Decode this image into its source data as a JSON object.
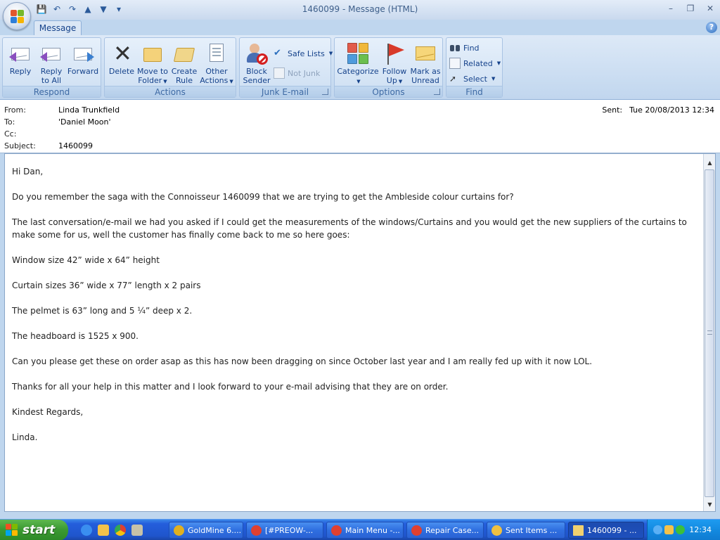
{
  "window": {
    "title": "1460099  - Message (HTML)",
    "minimize": "–",
    "restore": "❐",
    "close": "✕"
  },
  "qat": {
    "save": "💾",
    "undo": "↶",
    "redo": "↷",
    "prev": "▲",
    "next": "▼",
    "more": "▾"
  },
  "tabs": [
    {
      "label": "Message"
    }
  ],
  "help": "?",
  "ribbon": {
    "respond": {
      "label": "Respond",
      "reply": "Reply",
      "reply_all_1": "Reply",
      "reply_all_2": "to All",
      "forward": "Forward"
    },
    "actions": {
      "label": "Actions",
      "delete": "Delete",
      "move_1": "Move to",
      "move_2": "Folder",
      "create_1": "Create",
      "create_2": "Rule",
      "other_1": "Other",
      "other_2": "Actions"
    },
    "junk": {
      "label": "Junk E-mail",
      "block_1": "Block",
      "block_2": "Sender",
      "safe_lists": "Safe Lists",
      "not_junk": "Not Junk"
    },
    "options": {
      "label": "Options",
      "categorize": "Categorize",
      "follow_1": "Follow",
      "follow_2": "Up",
      "mark_1": "Mark as",
      "mark_2": "Unread"
    },
    "find": {
      "label": "Find",
      "find": "Find",
      "related": "Related",
      "select": "Select"
    },
    "colors": {
      "categorize": [
        "#e25b4b",
        "#f0b83a",
        "#4f9bdc",
        "#6bbf4f"
      ]
    }
  },
  "header": {
    "from_label": "From:",
    "from": "Linda Trunkfield",
    "to_label": "To:",
    "to": "'Daniel Moon'",
    "cc_label": "Cc:",
    "cc": "",
    "subject_label": "Subject:",
    "subject": "1460099",
    "sent_label": "Sent:",
    "sent": "Tue 20/08/2013 12:34"
  },
  "body": {
    "paragraphs": [
      "Hi Dan,",
      "Do you remember the saga with the Connoisseur 1460099 that we are trying to get the Ambleside colour curtains for?",
      "The last conversation/e-mail we had you asked if I could get the measurements of the windows/Curtains and you would get the new suppliers of the curtains to make some for us, well the customer has finally come back to me so here goes:",
      "Window size 42” wide x 64” height",
      "Curtain sizes 36” wide x 77” length x 2 pairs",
      "The pelmet is 63” long and 5 ¼” deep x 2.",
      "The headboard is 1525 x 900.",
      "Can you please get these on order asap as this has now been dragging on since October last year and I am really fed up with it now LOL.",
      "Thanks for all your help in this matter and I look forward to your e-mail advising that they are on order.",
      "Kindest Regards,",
      "Linda."
    ]
  },
  "taskbar": {
    "start": "start",
    "buttons": [
      {
        "label": "GoldMine 6....",
        "icon_color": "#e0b020"
      },
      {
        "label": "[#PREOW-...",
        "icon_color": "#e04030"
      },
      {
        "label": "Main Menu -...",
        "icon_color": "#e04030"
      },
      {
        "label": "Repair Case...",
        "icon_color": "#e04030"
      },
      {
        "label": "Sent Items ...",
        "icon_color": "#f0c040"
      },
      {
        "label": "1460099  - ...",
        "icon_color": "#f0d070"
      }
    ],
    "clock": "12:34"
  }
}
